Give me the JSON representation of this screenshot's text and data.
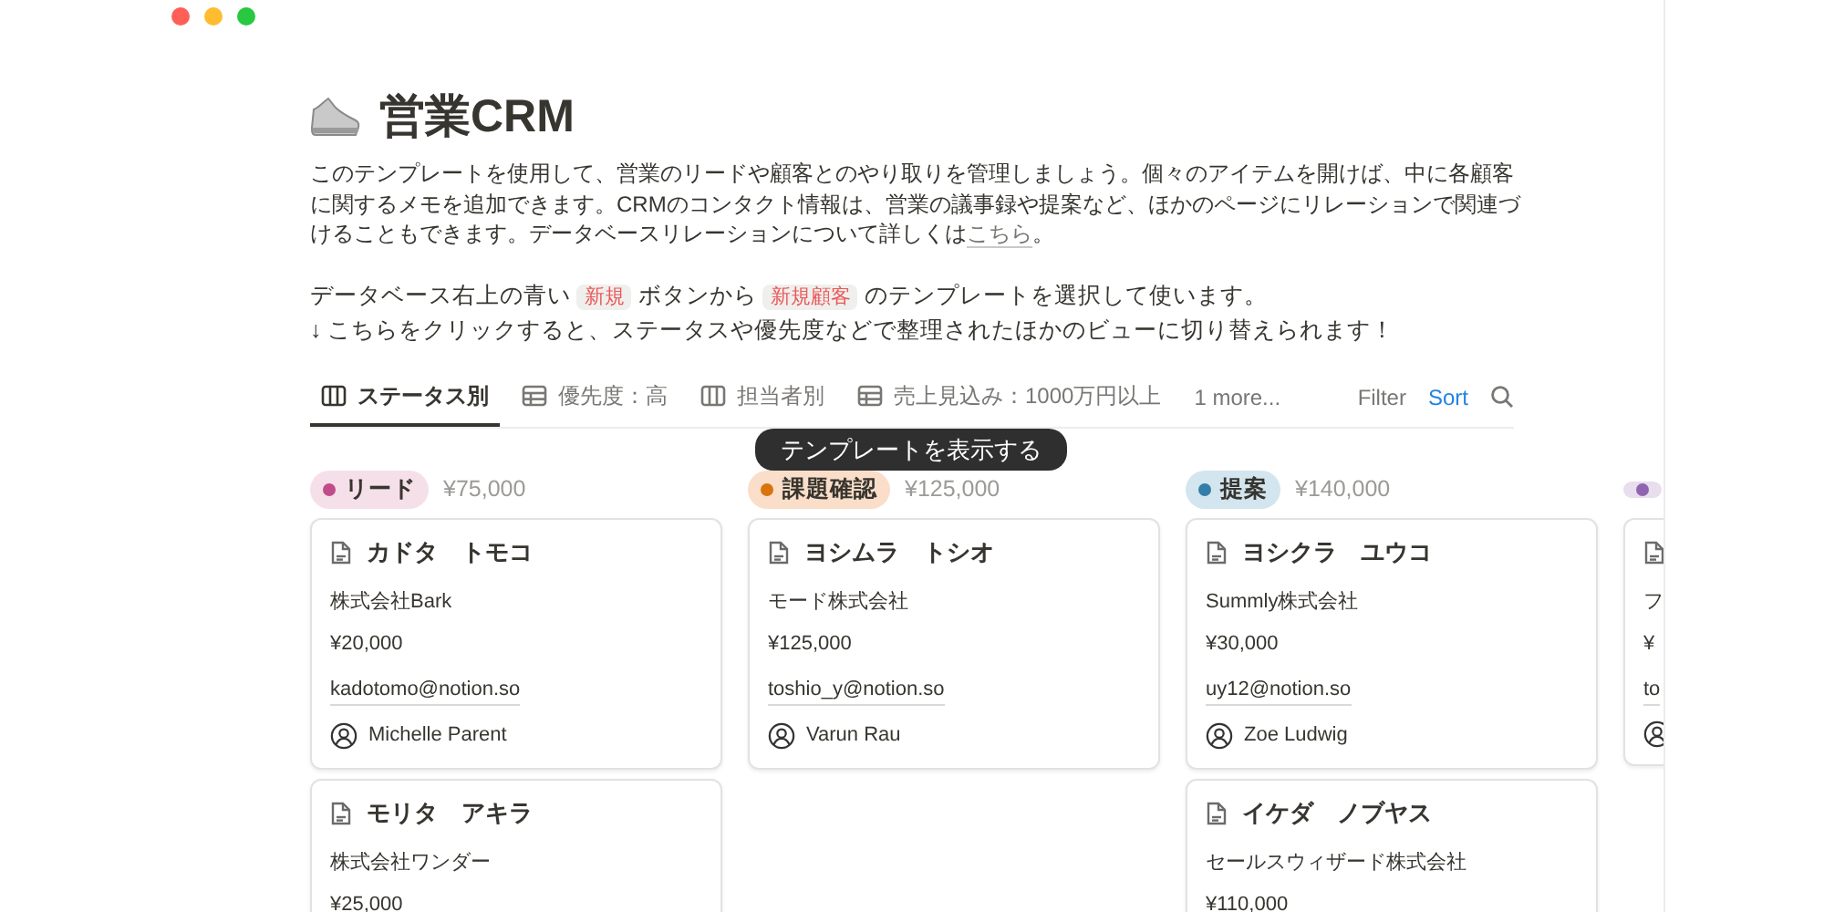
{
  "window": {
    "controls": [
      {
        "color": "#ff5f57"
      },
      {
        "color": "#febc2e"
      },
      {
        "color": "#28c840"
      }
    ]
  },
  "page": {
    "title": "営業CRM",
    "intro": [
      {
        "kind": "text",
        "text": "このテンプレートを使用して、営業のリードや顧客とのやり取りを管理しましょう。個々のアイテムを開けば、中に各顧客に関するメモを追加できます。CRMのコンタクト情報は、営業の議事録や提案など、ほかのページにリレーションで関連づけることもできます。データベースリレーションについて詳しくは"
      },
      {
        "kind": "link",
        "text": "こちら"
      },
      {
        "kind": "text",
        "text": "。"
      }
    ],
    "instructions": [
      {
        "kind": "text",
        "text": "データベース右上の青い "
      },
      {
        "kind": "code",
        "text": "新規"
      },
      {
        "kind": "text",
        "text": " ボタンから "
      },
      {
        "kind": "code",
        "text": "新規顧客"
      },
      {
        "kind": "text",
        "text": " のテンプレートを選択して使います。"
      }
    ],
    "hint": "↓ こちらをクリックすると、ステータスや優先度などで整理されたほかのビューに切り替えられます！"
  },
  "views": [
    {
      "kind": "board",
      "label": "ステータス別",
      "selected": true
    },
    {
      "kind": "table",
      "label": "優先度：高",
      "selected": false
    },
    {
      "kind": "board",
      "label": "担当者別",
      "selected": false
    },
    {
      "kind": "table",
      "label": "売上見込み：1000万円以上",
      "selected": false
    }
  ],
  "more_views": "1 more...",
  "toolbar": {
    "filter": "Filter",
    "sort": "Sort"
  },
  "tooltip": "テンプレートを表示する",
  "columns": [
    {
      "name": "リード",
      "color": "#c14c8a",
      "total": "¥75,000",
      "cards": [
        {
          "name": "カドタ　トモコ",
          "company": "株式会社Bark",
          "amount": "¥20,000",
          "email": "kadotomo@notion.so",
          "owner": "Michelle Parent"
        },
        {
          "name": "モリタ　アキラ",
          "company": "株式会社ワンダー",
          "amount": "¥25,000"
        }
      ]
    },
    {
      "name": "課題確認",
      "color": "#d9730d",
      "total": "¥125,000",
      "cards": [
        {
          "name": "ヨシムラ　トシオ",
          "company": "モード株式会社",
          "amount": "¥125,000",
          "email": "toshio_y@notion.so",
          "owner": "Varun Rau"
        }
      ]
    },
    {
      "name": "提案",
      "color": "#337ea9",
      "total": "¥140,000",
      "cards": [
        {
          "name": "ヨシクラ　ユウコ",
          "company": "Summly株式会社",
          "amount": "¥30,000",
          "email": "uy12@notion.so",
          "owner": "Zoe Ludwig"
        },
        {
          "name": "イケダ　ノブヤス",
          "company": "セールスウィザード株式会社",
          "amount": "¥110,000"
        }
      ]
    },
    {
      "color": "#9065b0",
      "cards": [
        {
          "company": "フ",
          "amount": "¥",
          "email": "to"
        }
      ]
    }
  ]
}
